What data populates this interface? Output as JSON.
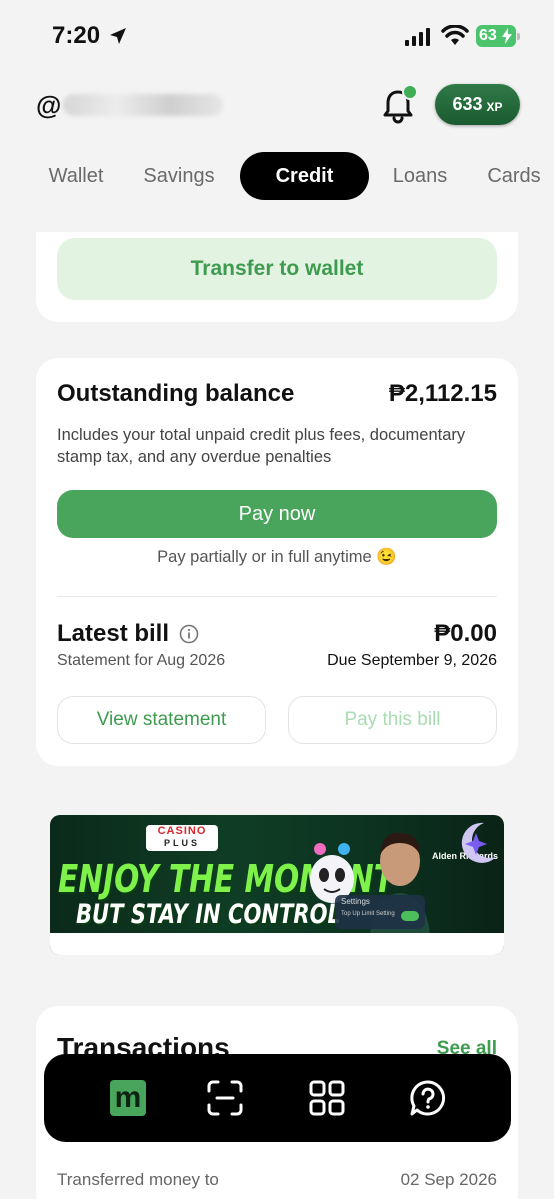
{
  "status_bar": {
    "time": "7:20",
    "battery": "63",
    "colors": {
      "battery": "#4cc36d"
    }
  },
  "header": {
    "handle_prefix": "@",
    "xp_value": "633",
    "xp_unit": "XP",
    "icons": [
      "bell-icon",
      "location-arrow-icon",
      "signal-icon",
      "wifi-icon"
    ]
  },
  "tabs": [
    {
      "label": "Wallet",
      "active": false
    },
    {
      "label": "Savings",
      "active": false
    },
    {
      "label": "Credit",
      "active": true
    },
    {
      "label": "Loans",
      "active": false
    },
    {
      "label": "Cards",
      "active": false
    }
  ],
  "transfer": {
    "label": "Transfer to wallet"
  },
  "outstanding": {
    "title": "Outstanding balance",
    "amount": "₱2,112.15",
    "description": "Includes your total unpaid credit plus fees, documentary stamp tax, and any overdue penalties",
    "pay_now_label": "Pay now",
    "pay_note": "Pay partially or in full anytime 😉"
  },
  "latest_bill": {
    "title": "Latest bill",
    "amount": "₱0.00",
    "statement": "Statement for Aug 2026",
    "due": "Due September 9, 2026",
    "view_statement_label": "View statement",
    "pay_bill_label": "Pay this bill"
  },
  "banner": {
    "brand_top": "CASINO",
    "brand_bottom": "PLUS",
    "headline": "ENJOY THE MOMENT",
    "subheadline": "BUT STAY IN CONTROL",
    "settings_label": "Settings",
    "settings_row": "Top Up Limit Setting",
    "endorser": "Alden Richards"
  },
  "transactions": {
    "title": "Transactions",
    "see_all_label": "See all",
    "rows": [
      {
        "description": "Transferred money to",
        "date": "02 Sep 2026"
      }
    ]
  },
  "bottom_nav": {
    "home_glyph": "m",
    "items": [
      "home-icon",
      "scan-icon",
      "apps-grid-icon",
      "help-icon"
    ]
  },
  "colors": {
    "accent": "#4aa55c",
    "accent_text": "#3e9b4f",
    "accent_light": "#e3f3e2",
    "background": "#f3f3f3"
  }
}
